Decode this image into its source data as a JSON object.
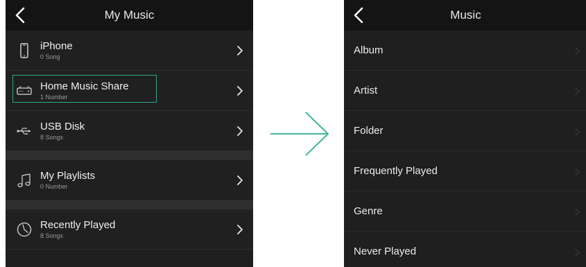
{
  "left": {
    "title": "My Music",
    "items": [
      {
        "label": "iPhone",
        "sub": "0 Song",
        "icon": "phone-icon"
      },
      {
        "label": "Home Music Share",
        "sub": "1 Number",
        "icon": "router-icon"
      },
      {
        "label": "USB Disk",
        "sub": "8 Songs",
        "icon": "usb-icon"
      },
      {
        "label": "My Playlists",
        "sub": "0 Number",
        "icon": "music-note-icon"
      },
      {
        "label": "Recently Played",
        "sub": "8 Songs",
        "icon": "clock-icon"
      }
    ]
  },
  "right": {
    "title": "Music",
    "items": [
      {
        "label": "Album"
      },
      {
        "label": "Artist"
      },
      {
        "label": "Folder"
      },
      {
        "label": "Frequently Played"
      },
      {
        "label": "Genre"
      },
      {
        "label": "Never Played"
      }
    ]
  },
  "colors": {
    "accent": "#2fa88a",
    "background": "#1e1e1e",
    "titlebar": "#141414",
    "arrow": "#3fb59a"
  }
}
